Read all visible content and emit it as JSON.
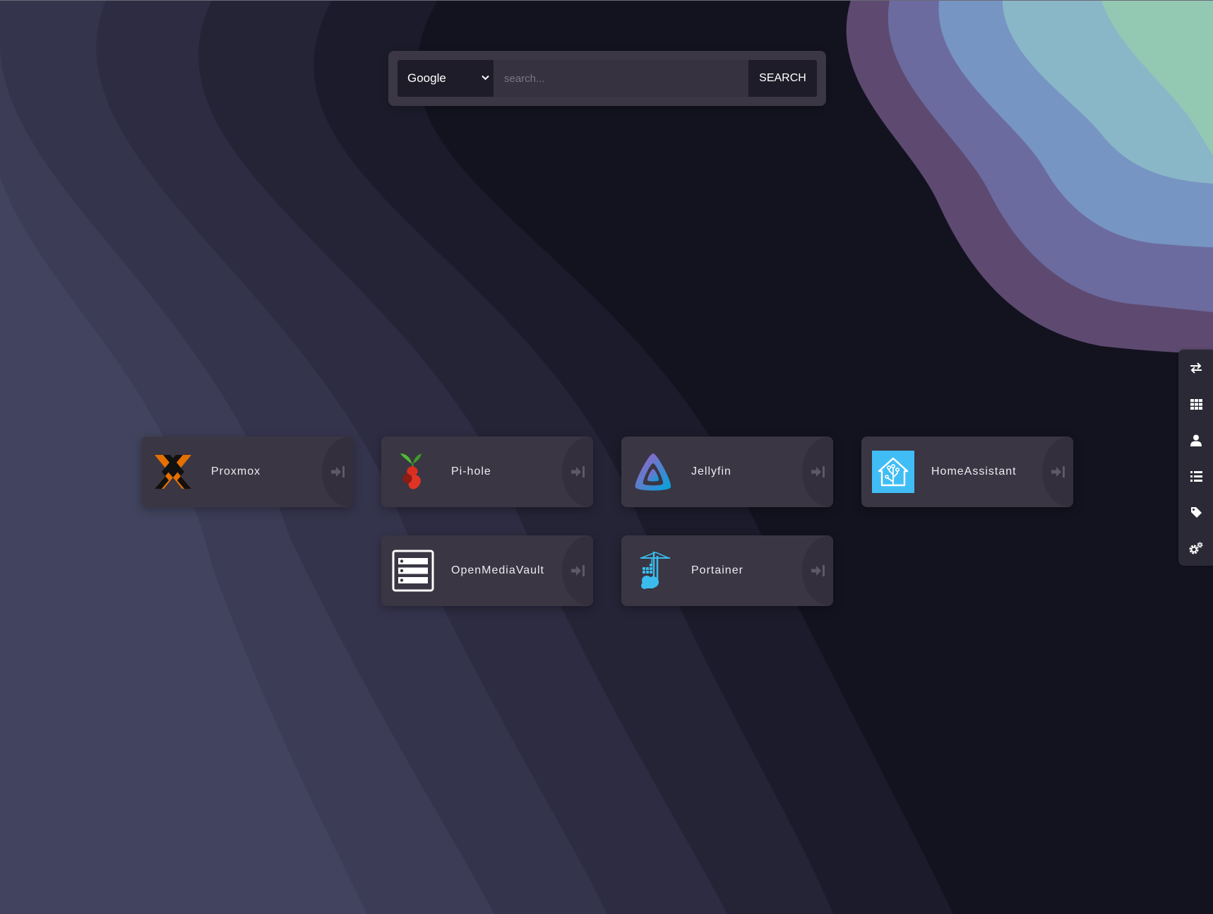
{
  "search": {
    "engine": "Google",
    "placeholder": "search...",
    "button_label": "SEARCH"
  },
  "apps": [
    {
      "name": "Proxmox",
      "icon": "proxmox-logo"
    },
    {
      "name": "Pi-hole",
      "icon": "pihole-logo"
    },
    {
      "name": "Jellyfin",
      "icon": "jellyfin-logo"
    },
    {
      "name": "HomeAssistant",
      "icon": "homeassistant-logo"
    },
    {
      "name": "OpenMediaVault",
      "icon": "openmediavault-logo"
    },
    {
      "name": "Portainer",
      "icon": "portainer-logo"
    }
  ],
  "side_rail": {
    "buttons": [
      {
        "icon": "swap-icon"
      },
      {
        "icon": "grid-icon"
      },
      {
        "icon": "user-icon"
      },
      {
        "icon": "list-icon"
      },
      {
        "icon": "tag-icon"
      },
      {
        "icon": "settings-cogs-icon"
      }
    ]
  },
  "colors": {
    "card_background": "#3a3643",
    "rail_background": "#2b2935",
    "search_background": "#3b3745",
    "proxmox_orange": "#e57000",
    "portainer_blue": "#3bbced",
    "homeassistant_blue": "#41bdf5"
  }
}
